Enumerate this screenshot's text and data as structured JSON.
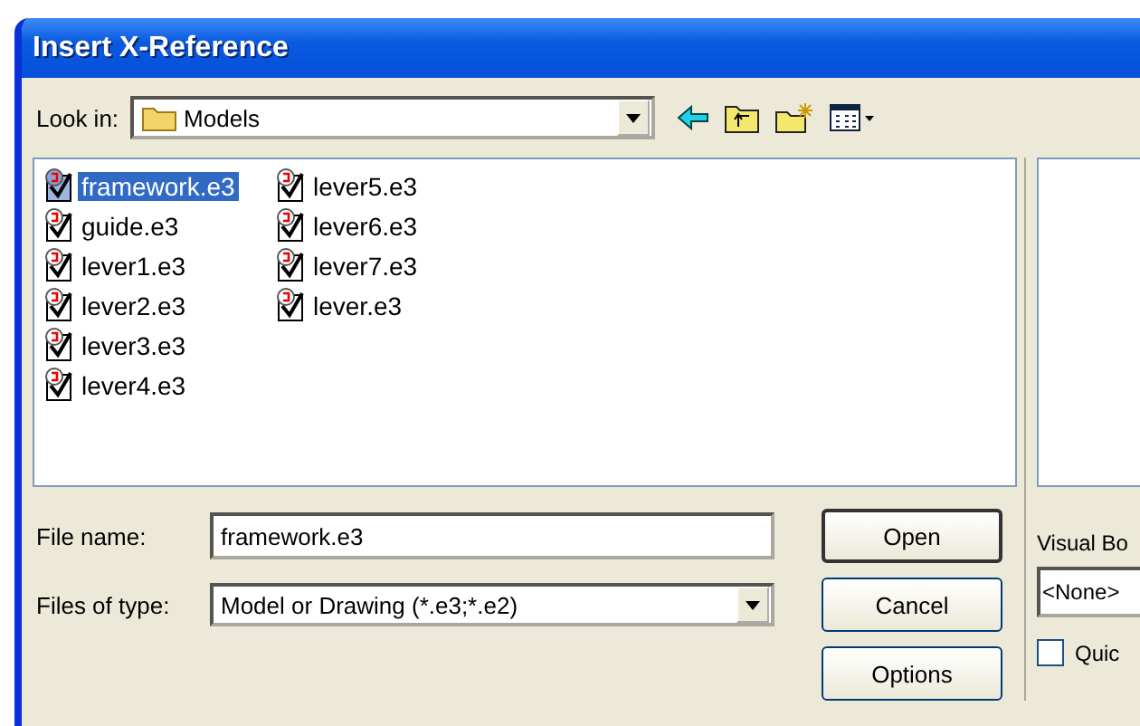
{
  "window": {
    "title": "Insert X-Reference"
  },
  "look_in": {
    "label": "Look in:",
    "value": "Models"
  },
  "files": [
    {
      "name": "framework.e3",
      "selected": true
    },
    {
      "name": "guide.e3",
      "selected": false
    },
    {
      "name": "lever1.e3",
      "selected": false
    },
    {
      "name": "lever2.e3",
      "selected": false
    },
    {
      "name": "lever3.e3",
      "selected": false
    },
    {
      "name": "lever4.e3",
      "selected": false
    },
    {
      "name": "lever5.e3",
      "selected": false
    },
    {
      "name": "lever6.e3",
      "selected": false
    },
    {
      "name": "lever7.e3",
      "selected": false
    },
    {
      "name": "lever.e3",
      "selected": false
    }
  ],
  "file_name": {
    "label": "File name:",
    "value": "framework.e3"
  },
  "file_type": {
    "label": "Files of type:",
    "value": "Model or Drawing (*.e3;*.e2)"
  },
  "buttons": [
    "Open",
    "Cancel",
    "Options"
  ],
  "visual": {
    "label": "Visual Bo",
    "value": "<None>"
  },
  "quick": {
    "label": "Quic",
    "checked": false
  }
}
